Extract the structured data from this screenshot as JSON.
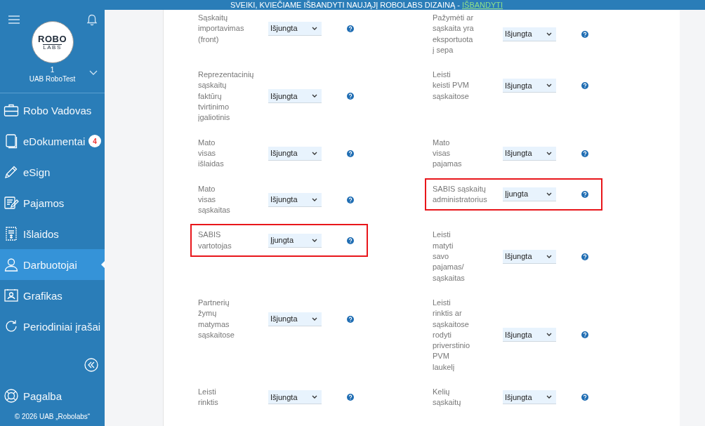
{
  "banner": {
    "text": "SVEIKI, KVIEČIAME IŠBANDYTI NAUJĄJĮ ROBOLABS DIZAINĄ - ",
    "link": "IŠBANDYTI"
  },
  "sidebar": {
    "logo": {
      "top": "ROBO",
      "bottom": "LABS"
    },
    "account_number": "1",
    "company": "UAB RoboTest",
    "items": [
      {
        "label": "Robo Vadovas",
        "kind": "briefcase",
        "selected": false
      },
      {
        "label": "eDokumentai",
        "kind": "documents",
        "selected": false,
        "badge": "4"
      },
      {
        "label": "eSign",
        "kind": "pen",
        "selected": false
      },
      {
        "label": "Pajamos",
        "kind": "edit",
        "selected": false
      },
      {
        "label": "Išlaidos",
        "kind": "receipt",
        "selected": false
      },
      {
        "label": "Darbuotojai",
        "kind": "person",
        "selected": true
      },
      {
        "label": "Grafikas",
        "kind": "calendar",
        "selected": false
      },
      {
        "label": "Periodiniai įrašai",
        "kind": "refresh",
        "selected": false
      }
    ],
    "help": "Pagalba",
    "footer": "© 2026 UAB „Robolabs“"
  },
  "settings": [
    {
      "label": "Sąskaitų\nimportavimas\n(front)",
      "value": "Išjungta",
      "highlighted": false
    },
    {
      "label": "Pažymėti ar\nsąskaita yra\neksportuota\nį sepa",
      "value": "Išjungta",
      "highlighted": false
    },
    {
      "label": "Reprezentacinių\nsąskaitų\nfaktūrų\ntvirtinimo\nįgaliotinis",
      "value": "Išjungta",
      "highlighted": false
    },
    {
      "label": "Leisti\nkeisti PVM\nsąskaitose",
      "value": "Išjungta",
      "highlighted": false
    },
    {
      "label": "Mato\nvisas\nišlaidas",
      "value": "Išjungta",
      "highlighted": false
    },
    {
      "label": "Mato\nvisas\npajamas",
      "value": "Išjungta",
      "highlighted": false
    },
    {
      "label": "Mato\nvisas\nsąskaitas",
      "value": "Išjungta",
      "highlighted": false
    },
    {
      "label": "SABIS sąskaitų\nadministratorius",
      "value": "Įjungta",
      "highlighted": true
    },
    {
      "label": "SABIS\nvartotojas",
      "value": "Įjungta",
      "highlighted": true
    },
    {
      "label": "Leisti\nmatyti\nsavo\npajamas/\nsąskaitas",
      "value": "Išjungta",
      "highlighted": false
    },
    {
      "label": "Partnerių\nžymų\nmatymas\nsąskaitose",
      "value": "Išjungta",
      "highlighted": false
    },
    {
      "label": "Leisti\nrinktis ar\nsąskaitose\nrodyti\npriverstinio\nPVM\nlaukelį",
      "value": "Išjungta",
      "highlighted": false
    },
    {
      "label": "Leisti\nrinktis",
      "value": "Išjungta",
      "highlighted": false
    },
    {
      "label": "Kelių\nsąskaitų",
      "value": "Išjungta",
      "highlighted": false
    }
  ]
}
